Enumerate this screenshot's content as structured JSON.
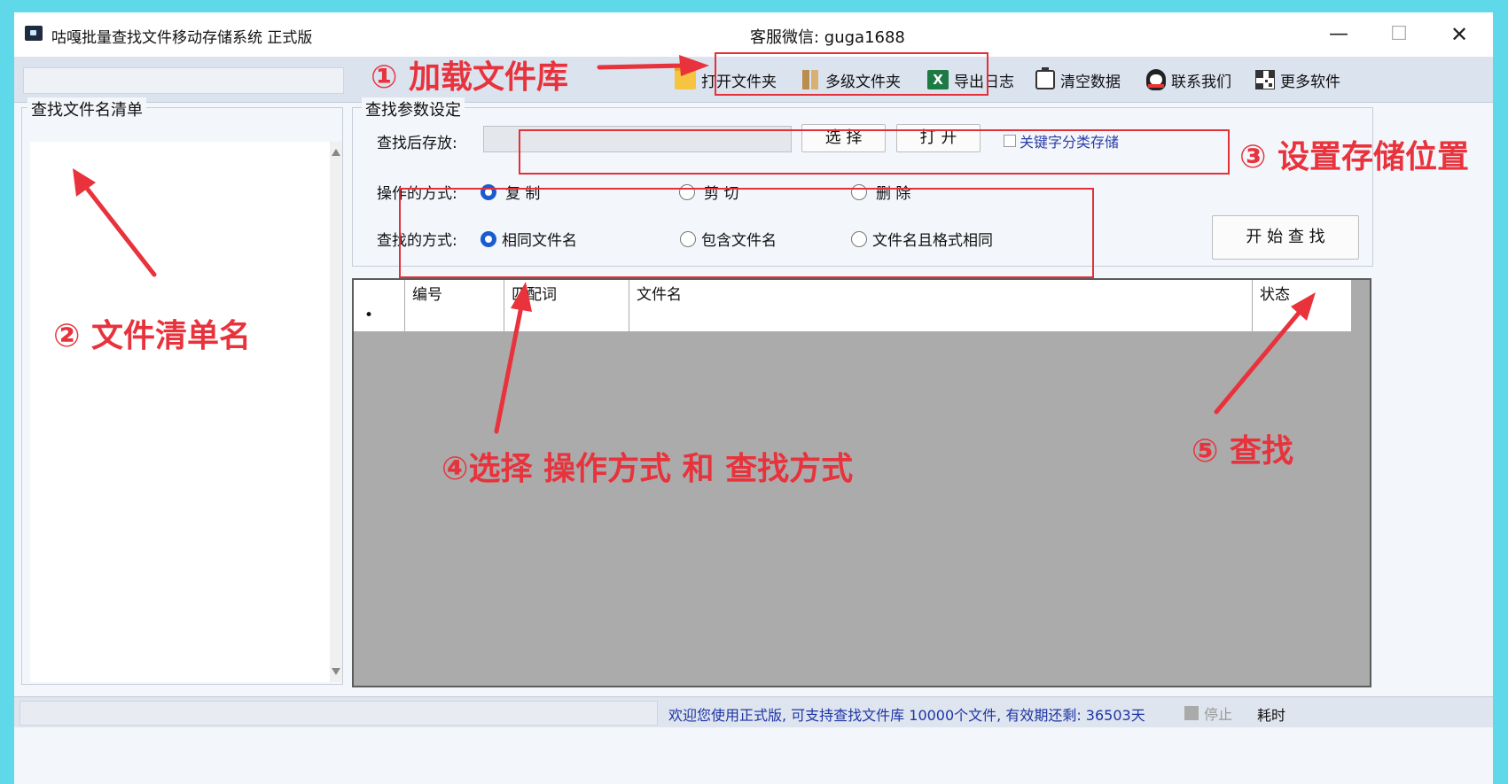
{
  "window": {
    "title": "咕嘎批量查找文件移动存储系统  正式版",
    "center_text": "客服微信: guga1688",
    "min_icon": "—",
    "max_icon": "☐",
    "close_icon": "✕"
  },
  "toolbar": {
    "open_folder": "打开文件夹",
    "multi_folder": "多级文件夹",
    "export_log": "导出日志",
    "clear_data": "清空数据",
    "contact_us": "联系我们",
    "more_software": "更多软件",
    "excel_glyph": "X"
  },
  "left_panel": {
    "legend": "查找文件名清单"
  },
  "params": {
    "legend": "查找参数设定",
    "save_label": "查找后存放:",
    "select_button": "选 择",
    "open_button": "打 开",
    "keyword_check": "关键字分类存储",
    "op_label": "操作的方式:",
    "op_options": [
      "复 制",
      "剪 切",
      "删 除"
    ],
    "search_label": "查找的方式:",
    "search_options": [
      "相同文件名",
      "包含文件名",
      "文件名且格式相同"
    ],
    "start_button": "开 始 查 找"
  },
  "grid": {
    "headers": [
      "",
      "编号",
      "匹配词",
      "文件名",
      "状态"
    ],
    "row_marker": "•"
  },
  "status": {
    "message": "欢迎您使用正式版, 可支持查找文件库 10000个文件, 有效期还剩: 36503天",
    "stop": "停止",
    "elapsed": "耗时"
  },
  "annotations": {
    "a1": "① 加载文件库",
    "a2": "② 文件清单名",
    "a3": "③ 设置存储位置",
    "a4": "④选择 操作方式 和 查找方式",
    "a5": "⑤ 查找"
  },
  "colors": {
    "annotation": "#e8323c",
    "status_text": "#1d34a6",
    "radio_selected": "#1a5bd0",
    "background": "#5fd8ea"
  }
}
